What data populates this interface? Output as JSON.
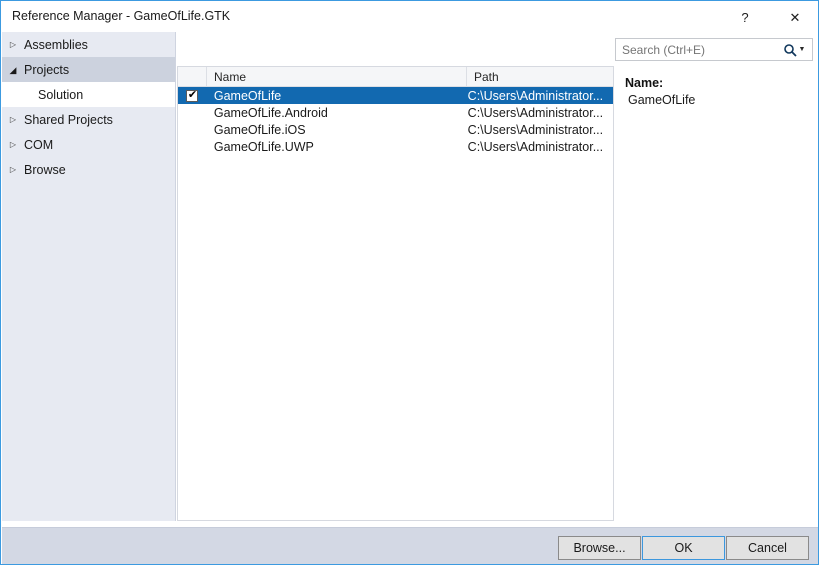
{
  "window": {
    "title": "Reference Manager - GameOfLife.GTK",
    "help_glyph": "?",
    "close_glyph": "✕"
  },
  "sidebar": {
    "items": [
      {
        "label": "Assemblies",
        "twisty": "▷",
        "state": "collapsed"
      },
      {
        "label": "Projects",
        "twisty": "◢",
        "state": "expanded"
      },
      {
        "label": "Solution",
        "twisty": "",
        "state": "child"
      },
      {
        "label": "Shared Projects",
        "twisty": "▷",
        "state": "collapsed"
      },
      {
        "label": "COM",
        "twisty": "▷",
        "state": "collapsed"
      },
      {
        "label": "Browse",
        "twisty": "▷",
        "state": "collapsed"
      }
    ]
  },
  "search": {
    "value": "",
    "placeholder": "Search (Ctrl+E)",
    "icon": "search-icon",
    "caret": "▼"
  },
  "list": {
    "columns": [
      "",
      "Name",
      "Path"
    ],
    "check_glyph": "✔",
    "rows": [
      {
        "checked": true,
        "name": "GameOfLife",
        "path": "C:\\Users\\Administrator...",
        "selected": true
      },
      {
        "checked": false,
        "name": "GameOfLife.Android",
        "path": "C:\\Users\\Administrator...",
        "selected": false
      },
      {
        "checked": false,
        "name": "GameOfLife.iOS",
        "path": "C:\\Users\\Administrator...",
        "selected": false
      },
      {
        "checked": false,
        "name": "GameOfLife.UWP",
        "path": "C:\\Users\\Administrator...",
        "selected": false
      }
    ]
  },
  "details": {
    "name_label": "Name:",
    "name_value": "GameOfLife"
  },
  "footer": {
    "browse_label": "Browse...",
    "ok_label": "OK",
    "cancel_label": "Cancel"
  },
  "colors": {
    "accent_border": "#3c9ae0",
    "selection": "#1269b0",
    "sidebar_bg": "#e7eaf2",
    "sidebar_selected": "#ccd2de",
    "footer_bg": "#d3d8e4",
    "default_button_border": "#3c97dd"
  }
}
